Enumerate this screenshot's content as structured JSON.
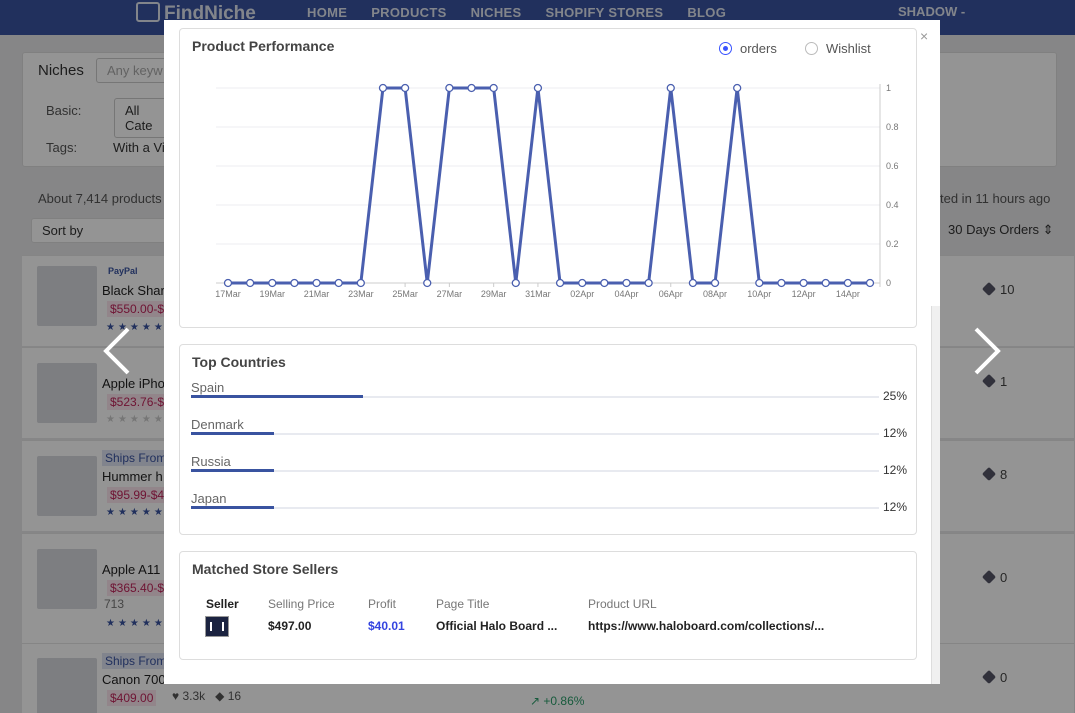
{
  "nav": {
    "logo": "FindNiche",
    "links": [
      "HOME",
      "PRODUCTS",
      "NICHES",
      "SHOPIFY STORES",
      "BLOG"
    ],
    "user": "SHADOW -"
  },
  "background": {
    "filter_label": "Niches",
    "filter_placeholder": "Any keyw",
    "basic_label": "Basic:",
    "basic_value": "All Cate",
    "tags_label": "Tags:",
    "tags_value": "With a Vi",
    "count_text": "About 7,414 products",
    "updated_text": "ted in 11 hours ago",
    "sort_label": "Sort by",
    "orders_sort": "30 Days Orders",
    "rows": [
      {
        "name": "Black Shark",
        "price": "$550.00-$",
        "count": "10"
      },
      {
        "name": "Apple iPho",
        "price": "$523.76-$",
        "count": "1"
      },
      {
        "name": "Hummer h",
        "price": "$95.99-$4",
        "count": "8",
        "badge": "Ships From"
      },
      {
        "name": "Apple A11",
        "price": "$365.40-$",
        "count": "0",
        "extra": "713"
      },
      {
        "name": "Canon 700",
        "price": "$409.00",
        "count": "0",
        "badge": "Ships From",
        "likes": "3.3k",
        "tags": "16",
        "change": "+0.86%"
      }
    ],
    "paypal": "PayPal"
  },
  "modal": {
    "close": "×",
    "performance": {
      "title": "Product Performance",
      "radio_orders": "orders",
      "radio_wishlist": "Wishlist"
    },
    "countries": {
      "title": "Top Countries",
      "items": [
        {
          "name": "Spain",
          "percent": "25%",
          "fraction": 0.25
        },
        {
          "name": "Denmark",
          "percent": "12%",
          "fraction": 0.12
        },
        {
          "name": "Russia",
          "percent": "12%",
          "fraction": 0.12
        },
        {
          "name": "Japan",
          "percent": "12%",
          "fraction": 0.12
        }
      ]
    },
    "sellers": {
      "title": "Matched Store Sellers",
      "headers": [
        "Seller",
        "Selling Price",
        "Profit",
        "Page Title",
        "Product URL"
      ],
      "row": {
        "price": "$497.00",
        "profit": "$40.01",
        "page_title": "Official Halo Board ...",
        "url": "https://www.haloboard.com/collections/..."
      }
    }
  },
  "chart_data": {
    "type": "line",
    "title": "",
    "xlabel": "",
    "ylabel": "",
    "ylim": [
      0,
      1
    ],
    "yticks": [
      "0",
      "0.2",
      "0.4",
      "0.6",
      "0.8",
      "1"
    ],
    "grid": true,
    "xtick_labels": [
      "17Mar",
      "19Mar",
      "21Mar",
      "23Mar",
      "25Mar",
      "27Mar",
      "29Mar",
      "31Mar",
      "02Apr",
      "04Apr",
      "06Apr",
      "08Apr",
      "10Apr",
      "12Apr",
      "14Apr"
    ],
    "x": [
      "17Mar",
      "18Mar",
      "19Mar",
      "20Mar",
      "21Mar",
      "22Mar",
      "23Mar",
      "24Mar",
      "25Mar",
      "26Mar",
      "27Mar",
      "28Mar",
      "29Mar",
      "30Mar",
      "31Mar",
      "01Apr",
      "02Apr",
      "03Apr",
      "04Apr",
      "05Apr",
      "06Apr",
      "07Apr",
      "08Apr",
      "09Apr",
      "10Apr",
      "11Apr",
      "12Apr",
      "13Apr",
      "14Apr",
      "15Apr"
    ],
    "series": [
      {
        "values": [
          0,
          0,
          0,
          0,
          0,
          0,
          0,
          1,
          1,
          0,
          1,
          1,
          1,
          0,
          1,
          0,
          0,
          0,
          0,
          0,
          1,
          0,
          0,
          1,
          0,
          0,
          0,
          0,
          0,
          0
        ]
      }
    ],
    "color": "#4a5faf"
  }
}
